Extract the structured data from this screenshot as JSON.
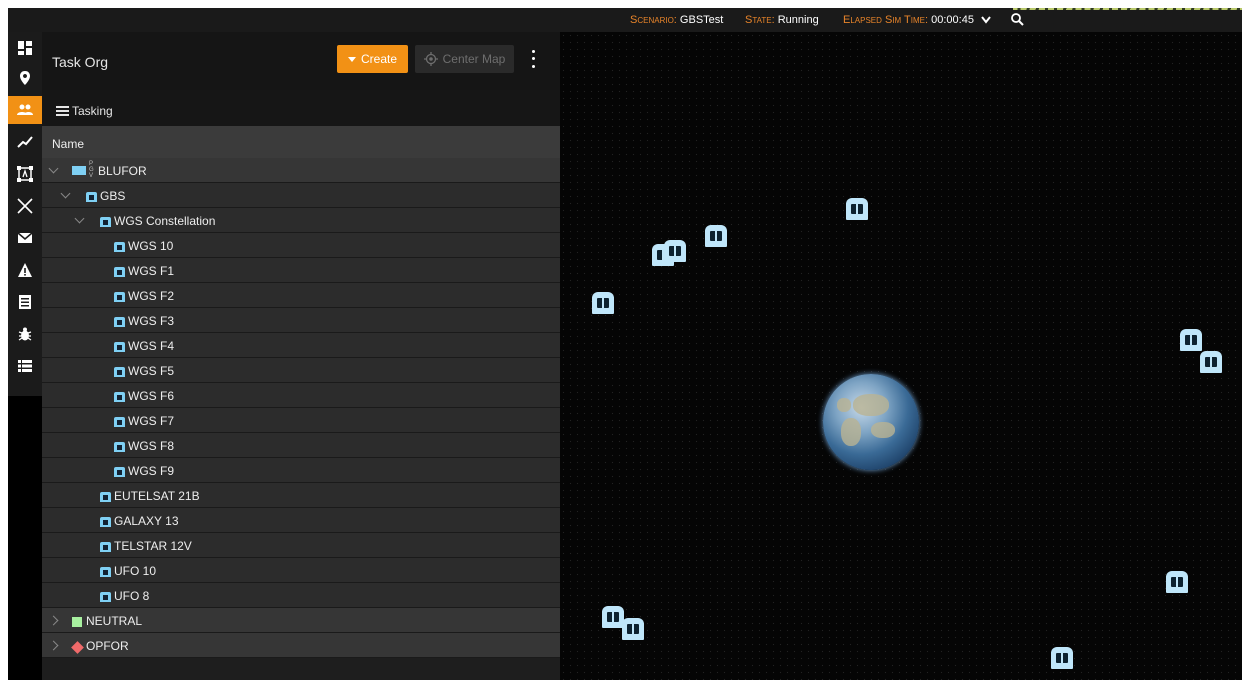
{
  "topbar": {
    "scenario_label": "Scenario",
    "scenario_value": "GBSTest",
    "state_label": "State",
    "state_value": "Running",
    "elapsed_label": "Elapsed Sim Time",
    "elapsed_value": "00:00:45",
    "icons": [
      "chevron-down-icon",
      "search-icon"
    ]
  },
  "rail": {
    "items": [
      {
        "name": "dashboard-icon",
        "active": false
      },
      {
        "name": "map-pin-icon",
        "active": false
      },
      {
        "name": "people-icon",
        "active": true
      },
      {
        "name": "trend-line-icon",
        "active": false
      },
      {
        "name": "text-frame-icon",
        "active": false
      },
      {
        "name": "crossed-swords-icon",
        "active": false
      },
      {
        "name": "mail-icon",
        "active": false
      },
      {
        "name": "warning-icon",
        "active": false
      },
      {
        "name": "document-icon",
        "active": false
      },
      {
        "name": "bug-icon",
        "active": false
      },
      {
        "name": "list-icon",
        "active": false
      }
    ]
  },
  "panel": {
    "title": "Task Org",
    "create_label": "Create",
    "center_map_label": "Center Map",
    "tasking_label": "Tasking",
    "column_name": "Name",
    "tree": [
      {
        "label": "BLUFOR",
        "depth": 0,
        "expanded": true,
        "icon": "blufor-flag-icon",
        "tag": "P G V"
      },
      {
        "label": "GBS",
        "depth": 1,
        "expanded": true,
        "icon": "satellite-icon"
      },
      {
        "label": "WGS Constellation",
        "depth": 2,
        "expanded": true,
        "icon": "satellite-group-icon"
      },
      {
        "label": "WGS 10",
        "depth": 3,
        "icon": "satellite-icon"
      },
      {
        "label": "WGS F1",
        "depth": 3,
        "icon": "satellite-icon"
      },
      {
        "label": "WGS F2",
        "depth": 3,
        "icon": "satellite-icon"
      },
      {
        "label": "WGS F3",
        "depth": 3,
        "icon": "satellite-icon"
      },
      {
        "label": "WGS F4",
        "depth": 3,
        "icon": "satellite-icon"
      },
      {
        "label": "WGS F5",
        "depth": 3,
        "icon": "satellite-icon"
      },
      {
        "label": "WGS F6",
        "depth": 3,
        "icon": "satellite-icon"
      },
      {
        "label": "WGS F7",
        "depth": 3,
        "icon": "satellite-icon"
      },
      {
        "label": "WGS F8",
        "depth": 3,
        "icon": "satellite-icon"
      },
      {
        "label": "WGS F9",
        "depth": 3,
        "icon": "satellite-icon"
      },
      {
        "label": "EUTELSAT 21B",
        "depth": 2,
        "icon": "satellite-icon"
      },
      {
        "label": "GALAXY 13",
        "depth": 2,
        "icon": "satellite-icon"
      },
      {
        "label": "TELSTAR 12V",
        "depth": 2,
        "icon": "satellite-icon"
      },
      {
        "label": "UFO 10",
        "depth": 2,
        "icon": "satellite-icon"
      },
      {
        "label": "UFO 8",
        "depth": 2,
        "icon": "satellite-icon"
      },
      {
        "label": "NEUTRAL",
        "depth": 0,
        "expanded": false,
        "icon": "neutral-square-icon"
      },
      {
        "label": "OPFOR",
        "depth": 0,
        "expanded": false,
        "icon": "opfor-diamond-icon"
      }
    ]
  },
  "colors": {
    "accent": "#f29115",
    "blufor": "#7fd0f4",
    "neutral": "#a8f0a0",
    "opfor": "#f06a6a",
    "topbar_label": "#e8842a"
  },
  "map": {
    "marker_icon": "satellite-marker-icon",
    "globe_icon": "earth-globe-icon"
  }
}
